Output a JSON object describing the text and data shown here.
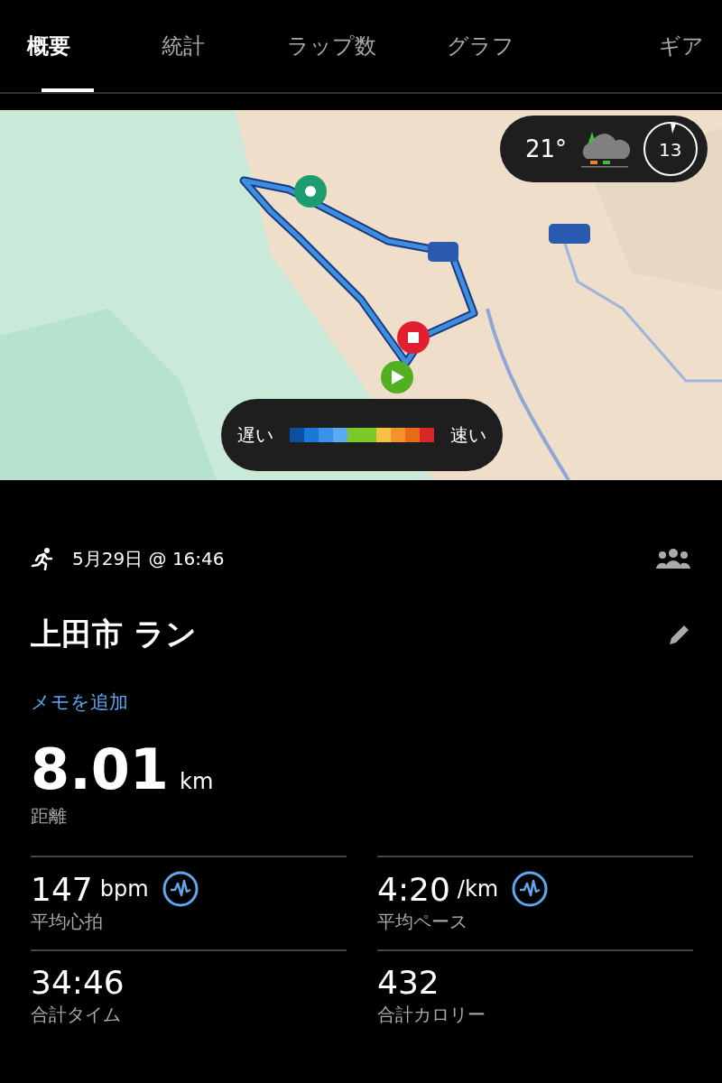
{
  "tabs": [
    {
      "label": "概要",
      "selected": true
    },
    {
      "label": "統計",
      "selected": false
    },
    {
      "label": "ラップ数",
      "selected": false
    },
    {
      "label": "グラフ",
      "selected": false
    },
    {
      "label": "ギア",
      "selected": false
    }
  ],
  "map": {
    "weather": {
      "temperature": "21°",
      "gauge": "13"
    },
    "legend": {
      "slow": "遅い",
      "fast": "速い",
      "segments": [
        {
          "color": "#0b4fa0"
        },
        {
          "color": "#1a78d8"
        },
        {
          "color": "#3a93e8"
        },
        {
          "color": "#5aaaf0"
        },
        {
          "color": "#7cc828"
        },
        {
          "color": "#7cc828"
        },
        {
          "color": "#f5c242"
        },
        {
          "color": "#f3922a"
        },
        {
          "color": "#e86a18"
        },
        {
          "color": "#d8262a"
        }
      ]
    }
  },
  "activity": {
    "datetime": "5月29日 @ 16:46",
    "title": "上田市 ラン",
    "add_note": "メモを追加"
  },
  "distance": {
    "value": "8.01",
    "unit": "km",
    "label": "距離"
  },
  "stats": [
    {
      "value": "147",
      "unit": "bpm",
      "label": "平均心拍",
      "has_chart": true
    },
    {
      "value": "4:20",
      "unit": "/km",
      "label": "平均ペース",
      "has_chart": true
    },
    {
      "value": "34:46",
      "label": "合計タイム",
      "has_chart": false
    },
    {
      "value": "432",
      "label": "合計カロリー",
      "has_chart": false
    }
  ]
}
